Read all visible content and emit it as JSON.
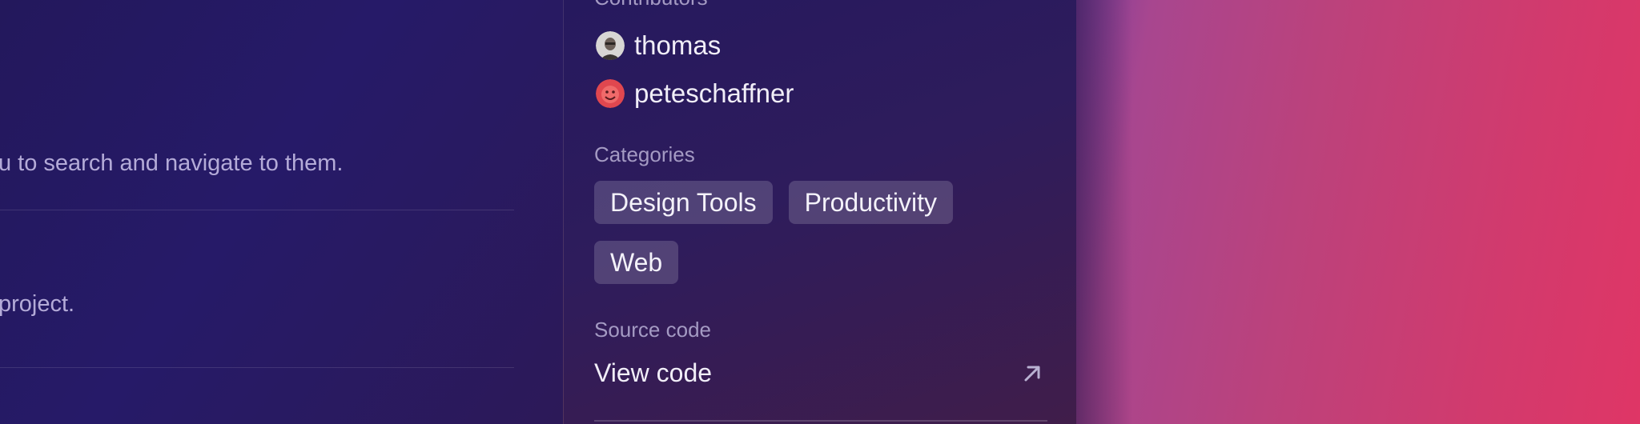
{
  "main": {
    "row1_text": "u to search and navigate to them.",
    "row2_text": "project."
  },
  "sidebar": {
    "contributors": {
      "title": "Contributors",
      "people": [
        {
          "name": "thomas",
          "avatar": "photo-avatar"
        },
        {
          "name": "peteschaffner",
          "avatar": "red-cartoon-avatar"
        }
      ]
    },
    "categories": {
      "title": "Categories",
      "items": [
        "Design Tools",
        "Productivity",
        "Web"
      ]
    },
    "source_code": {
      "title": "Source code",
      "link_label": "View code",
      "link_icon": "external-link-arrow-icon"
    }
  },
  "colors": {
    "accent_pink": "#df3666",
    "accent_purple": "#7d3f9a",
    "chip_bg": "rgba(255,255,255,0.17)"
  }
}
